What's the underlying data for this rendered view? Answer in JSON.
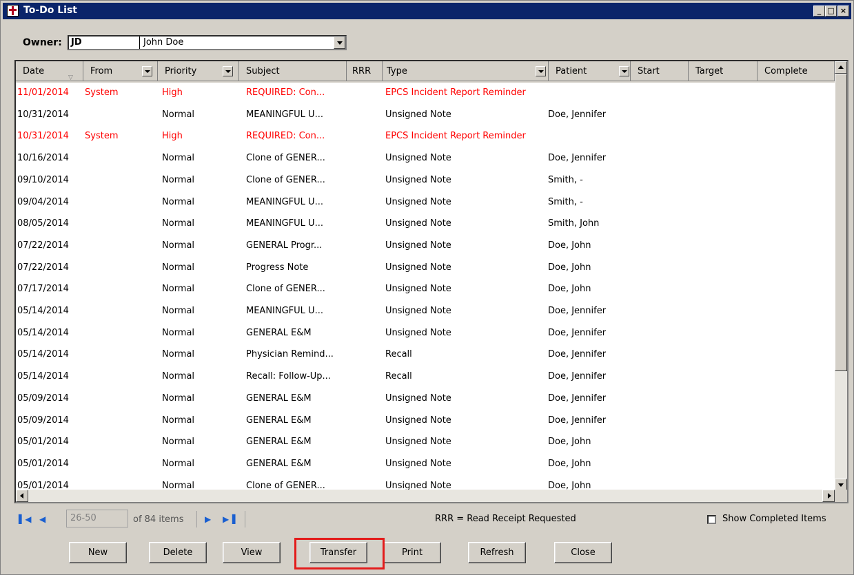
{
  "window": {
    "title": "To-Do List",
    "controls": [
      "_",
      "□",
      "×"
    ]
  },
  "owner": {
    "label": "Owner:",
    "code": "JD",
    "name": "John Doe"
  },
  "columns": [
    "Date",
    "From",
    "Priority",
    "Subject",
    "RRR",
    "Type",
    "Patient",
    "Start",
    "Target",
    "Complete"
  ],
  "rows": [
    {
      "date": "11/01/2014",
      "from": "System",
      "priority": "High",
      "subject": "REQUIRED: Con...",
      "type": "EPCS Incident Report Reminder",
      "patient": ""
    },
    {
      "date": "10/31/2014",
      "from": "",
      "priority": "Normal",
      "subject": "MEANINGFUL U...",
      "type": "Unsigned Note",
      "patient": "Doe, Jennifer"
    },
    {
      "date": "10/31/2014",
      "from": "System",
      "priority": "High",
      "subject": "REQUIRED: Con...",
      "type": "EPCS Incident Report Reminder",
      "patient": ""
    },
    {
      "date": "10/16/2014",
      "from": "",
      "priority": "Normal",
      "subject": "Clone of GENER...",
      "type": "Unsigned Note",
      "patient": "Doe, Jennifer"
    },
    {
      "date": "09/10/2014",
      "from": "",
      "priority": "Normal",
      "subject": "Clone of GENER...",
      "type": "Unsigned Note",
      "patient": "Smith, -"
    },
    {
      "date": "09/04/2014",
      "from": "",
      "priority": "Normal",
      "subject": "MEANINGFUL U...",
      "type": "Unsigned Note",
      "patient": "Smith, -"
    },
    {
      "date": "08/05/2014",
      "from": "",
      "priority": "Normal",
      "subject": "MEANINGFUL U...",
      "type": "Unsigned Note",
      "patient": "Smith, John"
    },
    {
      "date": "07/22/2014",
      "from": "",
      "priority": "Normal",
      "subject": "GENERAL Progr...",
      "type": "Unsigned Note",
      "patient": "Doe, John"
    },
    {
      "date": "07/22/2014",
      "from": "",
      "priority": "Normal",
      "subject": "Progress Note",
      "type": "Unsigned Note",
      "patient": "Doe, John"
    },
    {
      "date": "07/17/2014",
      "from": "",
      "priority": "Normal",
      "subject": "Clone of GENER...",
      "type": "Unsigned Note",
      "patient": "Doe, John"
    },
    {
      "date": "05/14/2014",
      "from": "",
      "priority": "Normal",
      "subject": "MEANINGFUL U...",
      "type": "Unsigned Note",
      "patient": "Doe, Jennifer"
    },
    {
      "date": "05/14/2014",
      "from": "",
      "priority": "Normal",
      "subject": "GENERAL E&M",
      "type": "Unsigned Note",
      "patient": "Doe, Jennifer"
    },
    {
      "date": "05/14/2014",
      "from": "",
      "priority": "Normal",
      "subject": "Physician Remind...",
      "type": "Recall",
      "patient": "Doe, Jennifer"
    },
    {
      "date": "05/14/2014",
      "from": "",
      "priority": "Normal",
      "subject": "Recall: Follow-Up...",
      "type": "Recall",
      "patient": "Doe, Jennifer"
    },
    {
      "date": "05/09/2014",
      "from": "",
      "priority": "Normal",
      "subject": "GENERAL E&M",
      "type": "Unsigned Note",
      "patient": "Doe, Jennifer"
    },
    {
      "date": "05/09/2014",
      "from": "",
      "priority": "Normal",
      "subject": "GENERAL E&M",
      "type": "Unsigned Note",
      "patient": "Doe, Jennifer"
    },
    {
      "date": "05/01/2014",
      "from": "",
      "priority": "Normal",
      "subject": "GENERAL E&M",
      "type": "Unsigned Note",
      "patient": "Doe, John"
    },
    {
      "date": "05/01/2014",
      "from": "",
      "priority": "Normal",
      "subject": "GENERAL E&M",
      "type": "Unsigned Note",
      "patient": "Doe, John"
    },
    {
      "date": "05/01/2014",
      "from": "",
      "priority": "Normal",
      "subject": "Clone of GENER...",
      "type": "Unsigned Note",
      "patient": "Doe, John"
    }
  ],
  "pager": {
    "range": "26-50",
    "of_text": "of 84 items"
  },
  "rrr_note": "RRR = Read Receipt Requested",
  "show_completed": {
    "label": "Show Completed Items",
    "checked": false
  },
  "buttons": {
    "new": "New",
    "delete": "Delete",
    "view": "View",
    "transfer": "Transfer",
    "print": "Print",
    "refresh": "Refresh",
    "close": "Close"
  },
  "colors": {
    "titlebar": "#0a246a",
    "high_priority": "#ff0000",
    "highlight_box": "#e31b1b",
    "pager_icon": "#1a5fd0"
  }
}
